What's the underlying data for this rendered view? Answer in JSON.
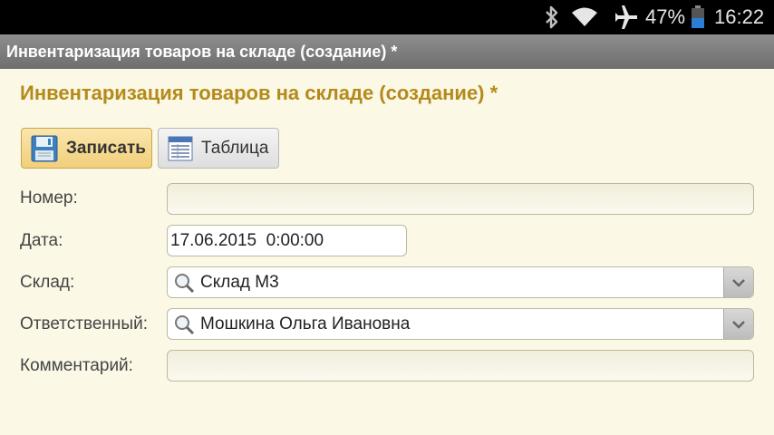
{
  "status_bar": {
    "battery_percent": "47%",
    "time": "16:22",
    "icons": [
      "bluetooth-icon",
      "wifi-icon",
      "airplane-icon",
      "battery-icon"
    ]
  },
  "window": {
    "title": "Инвентаризация товаров на складе (создание) *"
  },
  "form": {
    "title": "Инвентаризация товаров на складе (создание) *",
    "toolbar": {
      "save_label": "Записать",
      "table_label": "Таблица"
    },
    "fields": {
      "number": {
        "label": "Номер:",
        "value": ""
      },
      "date": {
        "label": "Дата:",
        "value": "17.06.2015  0:00:00"
      },
      "warehouse": {
        "label": "Склад:",
        "value": "Склад М3"
      },
      "responsible": {
        "label": "Ответственный:",
        "value": "Мошкина Ольга Ивановна"
      },
      "comment": {
        "label": "Комментарий:",
        "value": ""
      }
    }
  },
  "colors": {
    "title": "#b48a1a",
    "background": "#fbf8e6",
    "save_button": "#f1cf7a"
  }
}
